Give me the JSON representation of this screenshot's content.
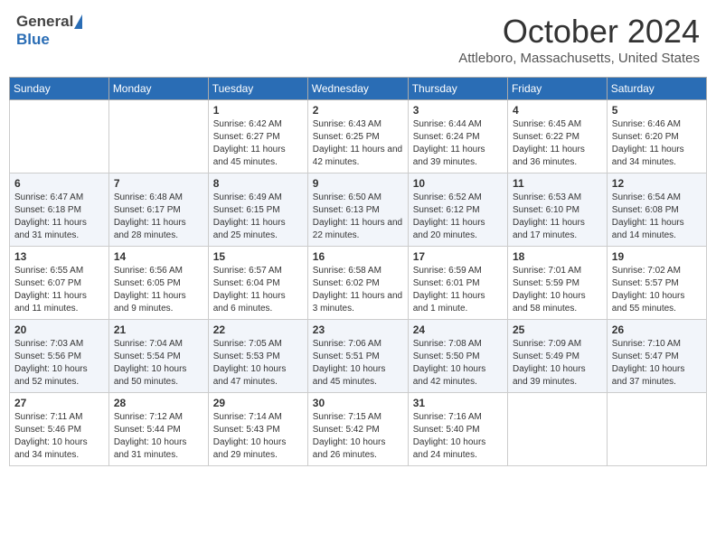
{
  "header": {
    "logo_general": "General",
    "logo_blue": "Blue",
    "month_title": "October 2024",
    "location": "Attleboro, Massachusetts, United States"
  },
  "days_of_week": [
    "Sunday",
    "Monday",
    "Tuesday",
    "Wednesday",
    "Thursday",
    "Friday",
    "Saturday"
  ],
  "weeks": [
    [
      {
        "day": "",
        "sunrise": "",
        "sunset": "",
        "daylight": ""
      },
      {
        "day": "",
        "sunrise": "",
        "sunset": "",
        "daylight": ""
      },
      {
        "day": "1",
        "sunrise": "Sunrise: 6:42 AM",
        "sunset": "Sunset: 6:27 PM",
        "daylight": "Daylight: 11 hours and 45 minutes."
      },
      {
        "day": "2",
        "sunrise": "Sunrise: 6:43 AM",
        "sunset": "Sunset: 6:25 PM",
        "daylight": "Daylight: 11 hours and 42 minutes."
      },
      {
        "day": "3",
        "sunrise": "Sunrise: 6:44 AM",
        "sunset": "Sunset: 6:24 PM",
        "daylight": "Daylight: 11 hours and 39 minutes."
      },
      {
        "day": "4",
        "sunrise": "Sunrise: 6:45 AM",
        "sunset": "Sunset: 6:22 PM",
        "daylight": "Daylight: 11 hours and 36 minutes."
      },
      {
        "day": "5",
        "sunrise": "Sunrise: 6:46 AM",
        "sunset": "Sunset: 6:20 PM",
        "daylight": "Daylight: 11 hours and 34 minutes."
      }
    ],
    [
      {
        "day": "6",
        "sunrise": "Sunrise: 6:47 AM",
        "sunset": "Sunset: 6:18 PM",
        "daylight": "Daylight: 11 hours and 31 minutes."
      },
      {
        "day": "7",
        "sunrise": "Sunrise: 6:48 AM",
        "sunset": "Sunset: 6:17 PM",
        "daylight": "Daylight: 11 hours and 28 minutes."
      },
      {
        "day": "8",
        "sunrise": "Sunrise: 6:49 AM",
        "sunset": "Sunset: 6:15 PM",
        "daylight": "Daylight: 11 hours and 25 minutes."
      },
      {
        "day": "9",
        "sunrise": "Sunrise: 6:50 AM",
        "sunset": "Sunset: 6:13 PM",
        "daylight": "Daylight: 11 hours and 22 minutes."
      },
      {
        "day": "10",
        "sunrise": "Sunrise: 6:52 AM",
        "sunset": "Sunset: 6:12 PM",
        "daylight": "Daylight: 11 hours and 20 minutes."
      },
      {
        "day": "11",
        "sunrise": "Sunrise: 6:53 AM",
        "sunset": "Sunset: 6:10 PM",
        "daylight": "Daylight: 11 hours and 17 minutes."
      },
      {
        "day": "12",
        "sunrise": "Sunrise: 6:54 AM",
        "sunset": "Sunset: 6:08 PM",
        "daylight": "Daylight: 11 hours and 14 minutes."
      }
    ],
    [
      {
        "day": "13",
        "sunrise": "Sunrise: 6:55 AM",
        "sunset": "Sunset: 6:07 PM",
        "daylight": "Daylight: 11 hours and 11 minutes."
      },
      {
        "day": "14",
        "sunrise": "Sunrise: 6:56 AM",
        "sunset": "Sunset: 6:05 PM",
        "daylight": "Daylight: 11 hours and 9 minutes."
      },
      {
        "day": "15",
        "sunrise": "Sunrise: 6:57 AM",
        "sunset": "Sunset: 6:04 PM",
        "daylight": "Daylight: 11 hours and 6 minutes."
      },
      {
        "day": "16",
        "sunrise": "Sunrise: 6:58 AM",
        "sunset": "Sunset: 6:02 PM",
        "daylight": "Daylight: 11 hours and 3 minutes."
      },
      {
        "day": "17",
        "sunrise": "Sunrise: 6:59 AM",
        "sunset": "Sunset: 6:01 PM",
        "daylight": "Daylight: 11 hours and 1 minute."
      },
      {
        "day": "18",
        "sunrise": "Sunrise: 7:01 AM",
        "sunset": "Sunset: 5:59 PM",
        "daylight": "Daylight: 10 hours and 58 minutes."
      },
      {
        "day": "19",
        "sunrise": "Sunrise: 7:02 AM",
        "sunset": "Sunset: 5:57 PM",
        "daylight": "Daylight: 10 hours and 55 minutes."
      }
    ],
    [
      {
        "day": "20",
        "sunrise": "Sunrise: 7:03 AM",
        "sunset": "Sunset: 5:56 PM",
        "daylight": "Daylight: 10 hours and 52 minutes."
      },
      {
        "day": "21",
        "sunrise": "Sunrise: 7:04 AM",
        "sunset": "Sunset: 5:54 PM",
        "daylight": "Daylight: 10 hours and 50 minutes."
      },
      {
        "day": "22",
        "sunrise": "Sunrise: 7:05 AM",
        "sunset": "Sunset: 5:53 PM",
        "daylight": "Daylight: 10 hours and 47 minutes."
      },
      {
        "day": "23",
        "sunrise": "Sunrise: 7:06 AM",
        "sunset": "Sunset: 5:51 PM",
        "daylight": "Daylight: 10 hours and 45 minutes."
      },
      {
        "day": "24",
        "sunrise": "Sunrise: 7:08 AM",
        "sunset": "Sunset: 5:50 PM",
        "daylight": "Daylight: 10 hours and 42 minutes."
      },
      {
        "day": "25",
        "sunrise": "Sunrise: 7:09 AM",
        "sunset": "Sunset: 5:49 PM",
        "daylight": "Daylight: 10 hours and 39 minutes."
      },
      {
        "day": "26",
        "sunrise": "Sunrise: 7:10 AM",
        "sunset": "Sunset: 5:47 PM",
        "daylight": "Daylight: 10 hours and 37 minutes."
      }
    ],
    [
      {
        "day": "27",
        "sunrise": "Sunrise: 7:11 AM",
        "sunset": "Sunset: 5:46 PM",
        "daylight": "Daylight: 10 hours and 34 minutes."
      },
      {
        "day": "28",
        "sunrise": "Sunrise: 7:12 AM",
        "sunset": "Sunset: 5:44 PM",
        "daylight": "Daylight: 10 hours and 31 minutes."
      },
      {
        "day": "29",
        "sunrise": "Sunrise: 7:14 AM",
        "sunset": "Sunset: 5:43 PM",
        "daylight": "Daylight: 10 hours and 29 minutes."
      },
      {
        "day": "30",
        "sunrise": "Sunrise: 7:15 AM",
        "sunset": "Sunset: 5:42 PM",
        "daylight": "Daylight: 10 hours and 26 minutes."
      },
      {
        "day": "31",
        "sunrise": "Sunrise: 7:16 AM",
        "sunset": "Sunset: 5:40 PM",
        "daylight": "Daylight: 10 hours and 24 minutes."
      },
      {
        "day": "",
        "sunrise": "",
        "sunset": "",
        "daylight": ""
      },
      {
        "day": "",
        "sunrise": "",
        "sunset": "",
        "daylight": ""
      }
    ]
  ]
}
